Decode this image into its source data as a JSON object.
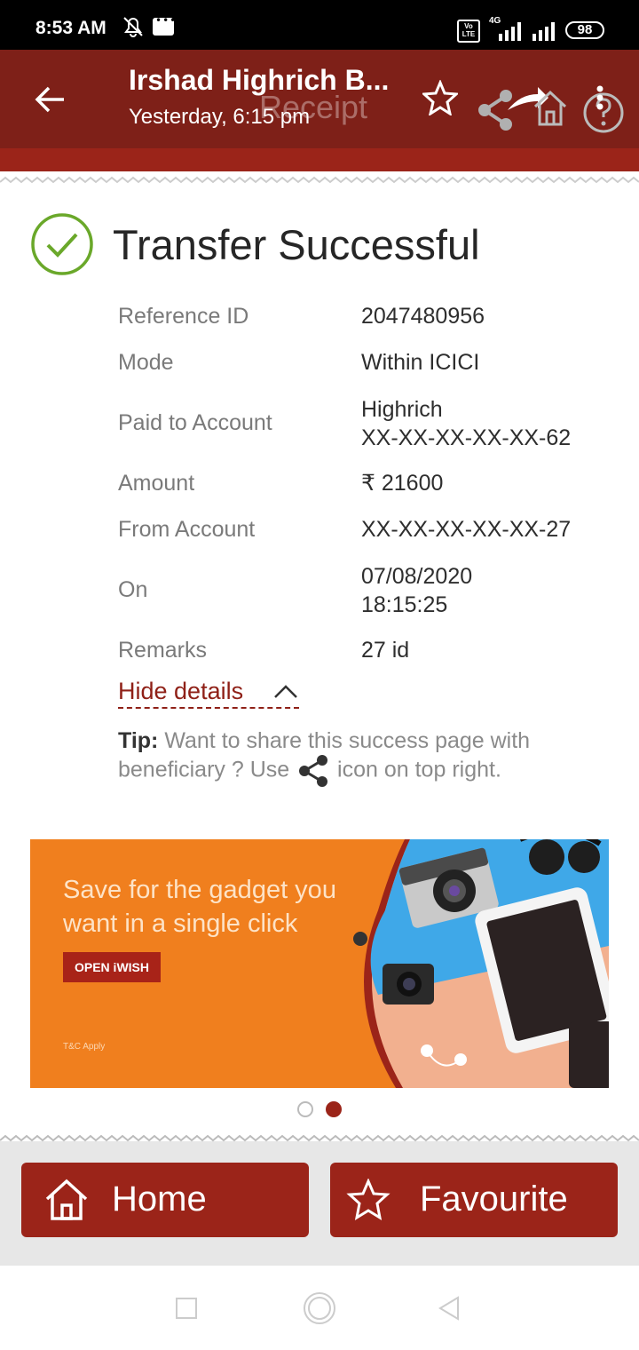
{
  "status_bar": {
    "time": "8:53 AM",
    "network_label": "4G",
    "volte_label": "Vo LTE",
    "battery": "98"
  },
  "header": {
    "title": "Irshad Highrich B...",
    "subtitle": "Yesterday, 6:15 pm",
    "overlay_text": "Receipt"
  },
  "receipt": {
    "status": "Transfer Successful",
    "details": [
      {
        "label": "Reference ID",
        "value": "2047480956"
      },
      {
        "label": "Mode",
        "value": "Within ICICI"
      },
      {
        "label": "Paid to Account",
        "value_line1": "Highrich",
        "value_line2": "XX-XX-XX-XX-XX-62"
      },
      {
        "label": "Amount",
        "value": "₹ 21600"
      },
      {
        "label": "From Account",
        "value": "XX-XX-XX-XX-XX-27"
      },
      {
        "label": "On",
        "value_line1": "07/08/2020",
        "value_line2": "18:15:25"
      },
      {
        "label": "Remarks",
        "value": "27 id"
      }
    ],
    "hide_details_label": "Hide details",
    "tip_label": "Tip:",
    "tip_text_before": " Want to share this success page with beneficiary ? Use ",
    "tip_text_after": " icon on top right."
  },
  "banner": {
    "headline": "Save for the gadget you want in a single click",
    "button_label": "OPEN iWISH",
    "terms": "T&C Apply",
    "active_slide": 2,
    "slide_count": 2
  },
  "footer": {
    "home_label": "Home",
    "favourite_label": "Favourite"
  },
  "colors": {
    "header": "#7e2018",
    "accent": "#9b2419",
    "success": "#6aa82a",
    "banner": "#f07f1e"
  }
}
